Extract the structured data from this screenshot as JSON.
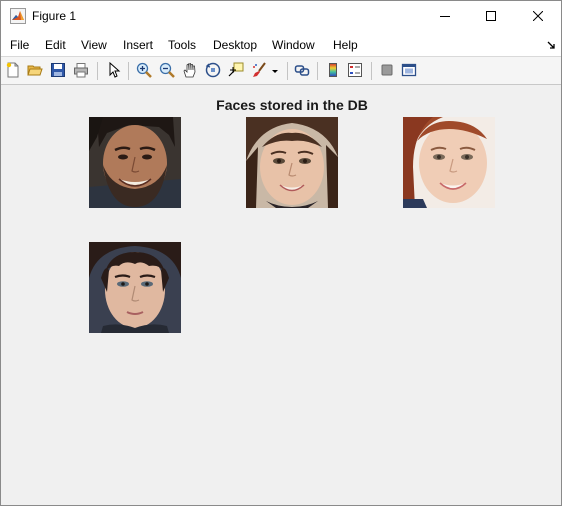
{
  "window": {
    "title": "Figure 1",
    "icons": {
      "app": "matlab-logo-icon",
      "minimize": "minimize-icon",
      "maximize": "maximize-icon",
      "close": "close-icon"
    }
  },
  "menu": {
    "items": [
      "File",
      "Edit",
      "View",
      "Insert",
      "Tools",
      "Desktop",
      "Window",
      "Help"
    ],
    "dock_arrow_icon": "dock-arrow-icon"
  },
  "toolbar": {
    "buttons": [
      "new-figure-icon",
      "open-file-icon",
      "save-icon",
      "print-icon",
      "select-pointer-icon",
      "zoom-in-icon",
      "zoom-out-icon",
      "pan-hand-icon",
      "rotate-3d-icon",
      "data-cursor-icon",
      "brush-icon",
      "brush-dropdown-icon",
      "link-plot-icon",
      "insert-colorbar-icon",
      "insert-legend-icon",
      "hide-plot-tools-icon",
      "show-plot-tools-icon"
    ]
  },
  "figure": {
    "title": "Faces stored in the DB",
    "images": [
      {
        "name": "face-image-1",
        "description": "bearded man smiling"
      },
      {
        "name": "face-image-2",
        "description": "young woman smiling"
      },
      {
        "name": "face-image-3",
        "description": "red-haired woman smiling"
      },
      {
        "name": "face-image-4",
        "description": "young man"
      }
    ]
  }
}
